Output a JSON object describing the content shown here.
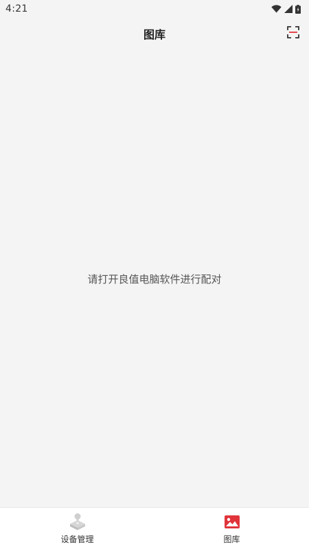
{
  "status_bar": {
    "time": "4:21",
    "icons": [
      "wifi-icon",
      "cellular-signal-icon",
      "battery-icon"
    ]
  },
  "header": {
    "title": "图库",
    "action_icon": "scan-icon",
    "accent_color": "#e0343a"
  },
  "main": {
    "empty_message": "请打开良值电脑软件进行配对"
  },
  "bottom_nav": {
    "items": [
      {
        "label": "设备管理",
        "icon": "device-management-icon",
        "active": false,
        "color": "#cfcfcf"
      },
      {
        "label": "图库",
        "icon": "gallery-icon",
        "active": true,
        "color": "#e0343a"
      }
    ]
  }
}
